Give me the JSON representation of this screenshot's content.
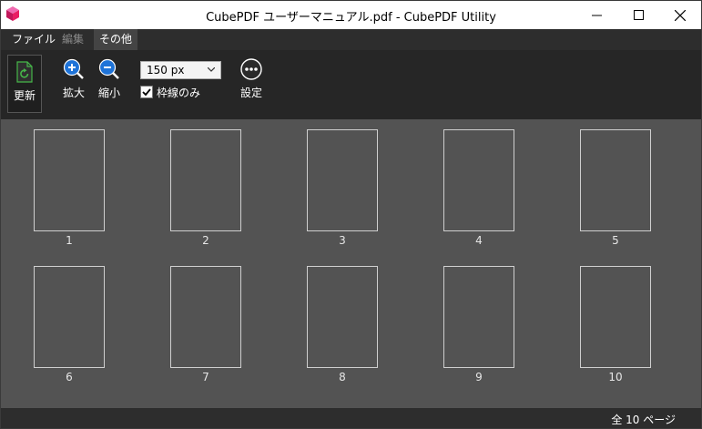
{
  "window": {
    "title": "CubePDF ユーザーマニュアル.pdf - CubePDF Utility"
  },
  "menu": {
    "items": [
      {
        "label": "ファイル",
        "state": "normal"
      },
      {
        "label": "編集",
        "state": "disabled"
      },
      {
        "label": "その他",
        "state": "active"
      }
    ]
  },
  "toolbar": {
    "refresh_label": "更新",
    "zoom_in_label": "拡大",
    "zoom_out_label": "縮小",
    "size_select_value": "150 px",
    "frame_only_label": "枠線のみ",
    "frame_only_checked": true,
    "settings_label": "設定"
  },
  "pages": {
    "numbers": [
      "1",
      "2",
      "3",
      "4",
      "5",
      "6",
      "7",
      "8",
      "9",
      "10"
    ]
  },
  "status": {
    "text": "全 10 ページ"
  },
  "colors": {
    "accent": "#1e73d8",
    "refresh_green": "#46b649",
    "background": "#535353",
    "toolbar": "#262626",
    "menubar": "#2d2d2d"
  }
}
